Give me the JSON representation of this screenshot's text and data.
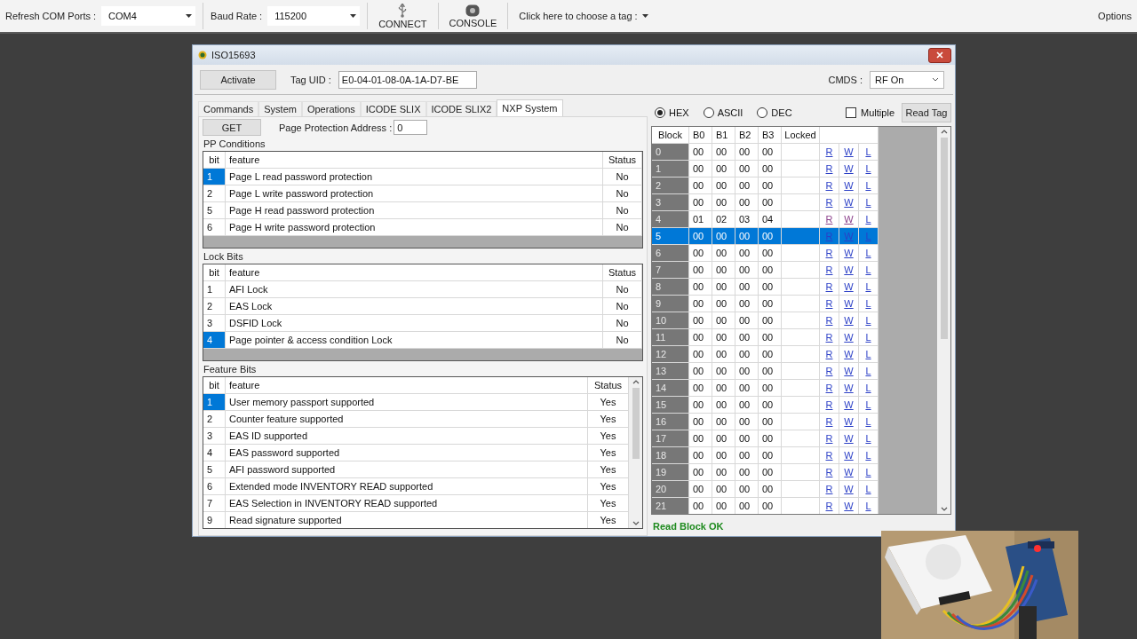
{
  "toolbar": {
    "com_label": "Refresh COM Ports :",
    "com_port": "COM4",
    "baud_label": "Baud Rate :",
    "baud_rate": "115200",
    "connect": "CONNECT",
    "console": "CONSOLE",
    "tag_chooser": "Click here to choose a tag :",
    "options": "Options"
  },
  "dialog": {
    "title": "ISO15693",
    "activate": "Activate",
    "tag_uid_label": "Tag UID :",
    "tag_uid": "E0-04-01-08-0A-1A-D7-BE",
    "cmds_label": "CMDS :",
    "cmds": "RF On",
    "tabs": [
      {
        "label": "Commands",
        "selected": false
      },
      {
        "label": "System",
        "selected": false
      },
      {
        "label": "Operations",
        "selected": false
      },
      {
        "label": "ICODE SLIX",
        "selected": false
      },
      {
        "label": "ICODE SLIX2",
        "selected": false
      },
      {
        "label": "NXP System",
        "selected": true
      }
    ],
    "get": "GET",
    "page_protection_label": "Page Protection Address :",
    "page_protection_address": "0",
    "sections": [
      {
        "title": "PP Conditions",
        "columns": [
          "bit",
          "feature",
          "Status"
        ],
        "scrollable": false,
        "rows": [
          {
            "bit": "1",
            "feature": "Page L read password protection",
            "status": "No",
            "selected": true
          },
          {
            "bit": "2",
            "feature": "Page L write password protection",
            "status": "No",
            "selected": false
          },
          {
            "bit": "5",
            "feature": "Page H read password protection",
            "status": "No",
            "selected": false
          },
          {
            "bit": "6",
            "feature": "Page H write password protection",
            "status": "No",
            "selected": false
          }
        ]
      },
      {
        "title": "Lock Bits",
        "columns": [
          "bit",
          "feature",
          "Status"
        ],
        "scrollable": false,
        "rows": [
          {
            "bit": "1",
            "feature": "AFI Lock",
            "status": "No",
            "selected": false
          },
          {
            "bit": "2",
            "feature": "EAS Lock",
            "status": "No",
            "selected": false
          },
          {
            "bit": "3",
            "feature": "DSFID Lock",
            "status": "No",
            "selected": false
          },
          {
            "bit": "4",
            "feature": "Page pointer & access condition Lock",
            "status": "No",
            "selected": true
          }
        ]
      },
      {
        "title": "Feature Bits",
        "columns": [
          "bit",
          "feature",
          "Status"
        ],
        "scrollable": true,
        "rows": [
          {
            "bit": "1",
            "feature": "User memory passport supported",
            "status": "Yes",
            "selected": true
          },
          {
            "bit": "2",
            "feature": "Counter feature supported",
            "status": "Yes",
            "selected": false
          },
          {
            "bit": "3",
            "feature": "EAS ID supported",
            "status": "Yes",
            "selected": false
          },
          {
            "bit": "4",
            "feature": "EAS password supported",
            "status": "Yes",
            "selected": false
          },
          {
            "bit": "5",
            "feature": "AFI password supported",
            "status": "Yes",
            "selected": false
          },
          {
            "bit": "6",
            "feature": "Extended mode INVENTORY READ supported",
            "status": "Yes",
            "selected": false
          },
          {
            "bit": "7",
            "feature": "EAS Selection in INVENTORY READ supported",
            "status": "Yes",
            "selected": false
          },
          {
            "bit": "9",
            "feature": "Read signature supported",
            "status": "Yes",
            "selected": false
          }
        ]
      }
    ],
    "formats": [
      {
        "label": "HEX",
        "selected": true
      },
      {
        "label": "ASCII",
        "selected": false
      },
      {
        "label": "DEC",
        "selected": false
      }
    ],
    "multiple": {
      "label": "Multiple",
      "checked": false
    },
    "read_tag": "Read Tag",
    "blocks": {
      "columns": [
        "Block",
        "B0",
        "B1",
        "B2",
        "B3",
        "Locked"
      ],
      "rows": [
        {
          "block": "0",
          "bytes": [
            "00",
            "00",
            "00",
            "00"
          ],
          "actions": [
            "R",
            "W",
            "L"
          ],
          "selected": false,
          "visited": false
        },
        {
          "block": "1",
          "bytes": [
            "00",
            "00",
            "00",
            "00"
          ],
          "actions": [
            "R",
            "W",
            "L"
          ],
          "selected": false,
          "visited": false
        },
        {
          "block": "2",
          "bytes": [
            "00",
            "00",
            "00",
            "00"
          ],
          "actions": [
            "R",
            "W",
            "L"
          ],
          "selected": false,
          "visited": false
        },
        {
          "block": "3",
          "bytes": [
            "00",
            "00",
            "00",
            "00"
          ],
          "actions": [
            "R",
            "W",
            "L"
          ],
          "selected": false,
          "visited": false
        },
        {
          "block": "4",
          "bytes": [
            "01",
            "02",
            "03",
            "04"
          ],
          "actions": [
            "R",
            "W",
            "L"
          ],
          "selected": false,
          "visited": true
        },
        {
          "block": "5",
          "bytes": [
            "00",
            "00",
            "00",
            "00"
          ],
          "actions": [
            "R",
            "W",
            "L"
          ],
          "selected": true,
          "visited": false
        },
        {
          "block": "6",
          "bytes": [
            "00",
            "00",
            "00",
            "00"
          ],
          "actions": [
            "R",
            "W",
            "L"
          ],
          "selected": false,
          "visited": false
        },
        {
          "block": "7",
          "bytes": [
            "00",
            "00",
            "00",
            "00"
          ],
          "actions": [
            "R",
            "W",
            "L"
          ],
          "selected": false,
          "visited": false
        },
        {
          "block": "8",
          "bytes": [
            "00",
            "00",
            "00",
            "00"
          ],
          "actions": [
            "R",
            "W",
            "L"
          ],
          "selected": false,
          "visited": false
        },
        {
          "block": "9",
          "bytes": [
            "00",
            "00",
            "00",
            "00"
          ],
          "actions": [
            "R",
            "W",
            "L"
          ],
          "selected": false,
          "visited": false
        },
        {
          "block": "10",
          "bytes": [
            "00",
            "00",
            "00",
            "00"
          ],
          "actions": [
            "R",
            "W",
            "L"
          ],
          "selected": false,
          "visited": false
        },
        {
          "block": "11",
          "bytes": [
            "00",
            "00",
            "00",
            "00"
          ],
          "actions": [
            "R",
            "W",
            "L"
          ],
          "selected": false,
          "visited": false
        },
        {
          "block": "12",
          "bytes": [
            "00",
            "00",
            "00",
            "00"
          ],
          "actions": [
            "R",
            "W",
            "L"
          ],
          "selected": false,
          "visited": false
        },
        {
          "block": "13",
          "bytes": [
            "00",
            "00",
            "00",
            "00"
          ],
          "actions": [
            "R",
            "W",
            "L"
          ],
          "selected": false,
          "visited": false
        },
        {
          "block": "14",
          "bytes": [
            "00",
            "00",
            "00",
            "00"
          ],
          "actions": [
            "R",
            "W",
            "L"
          ],
          "selected": false,
          "visited": false
        },
        {
          "block": "15",
          "bytes": [
            "00",
            "00",
            "00",
            "00"
          ],
          "actions": [
            "R",
            "W",
            "L"
          ],
          "selected": false,
          "visited": false
        },
        {
          "block": "16",
          "bytes": [
            "00",
            "00",
            "00",
            "00"
          ],
          "actions": [
            "R",
            "W",
            "L"
          ],
          "selected": false,
          "visited": false
        },
        {
          "block": "17",
          "bytes": [
            "00",
            "00",
            "00",
            "00"
          ],
          "actions": [
            "R",
            "W",
            "L"
          ],
          "selected": false,
          "visited": false
        },
        {
          "block": "18",
          "bytes": [
            "00",
            "00",
            "00",
            "00"
          ],
          "actions": [
            "R",
            "W",
            "L"
          ],
          "selected": false,
          "visited": false
        },
        {
          "block": "19",
          "bytes": [
            "00",
            "00",
            "00",
            "00"
          ],
          "actions": [
            "R",
            "W",
            "L"
          ],
          "selected": false,
          "visited": false
        },
        {
          "block": "20",
          "bytes": [
            "00",
            "00",
            "00",
            "00"
          ],
          "actions": [
            "R",
            "W",
            "L"
          ],
          "selected": false,
          "visited": false
        },
        {
          "block": "21",
          "bytes": [
            "00",
            "00",
            "00",
            "00"
          ],
          "actions": [
            "R",
            "W",
            "L"
          ],
          "selected": false,
          "visited": false
        }
      ]
    },
    "status": "Read Block OK"
  }
}
